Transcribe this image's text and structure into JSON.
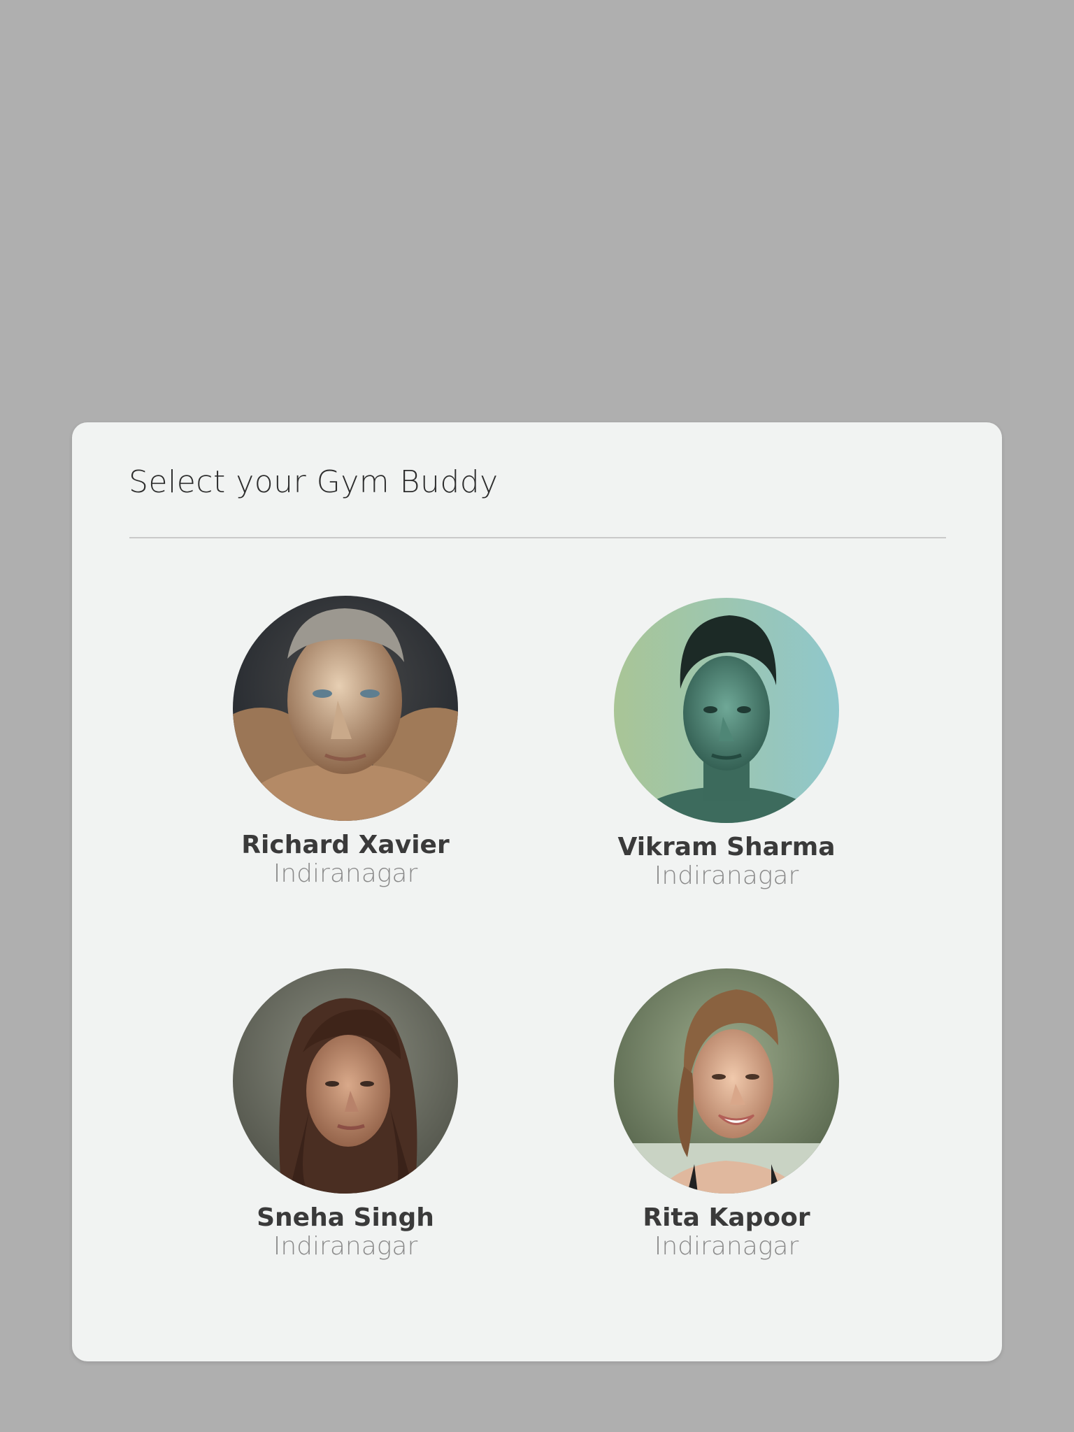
{
  "dialog": {
    "title": "Select your Gym Buddy"
  },
  "buddies": [
    {
      "name": "Richard Xavier",
      "location": "Indiranagar",
      "avatar_icon": "man-portrait-photo"
    },
    {
      "name": "Vikram Sharma",
      "location": "Indiranagar",
      "avatar_icon": "man-portrait-photo"
    },
    {
      "name": "Sneha Singh",
      "location": "Indiranagar",
      "avatar_icon": "woman-portrait-photo"
    },
    {
      "name": "Rita Kapoor",
      "location": "Indiranagar",
      "avatar_icon": "woman-portrait-photo"
    }
  ],
  "colors": {
    "backdrop": "#afafaf",
    "dialog_bg": "#f1f3f2",
    "name_text": "#3a3a3a",
    "location_text": "#8a8a8a"
  }
}
